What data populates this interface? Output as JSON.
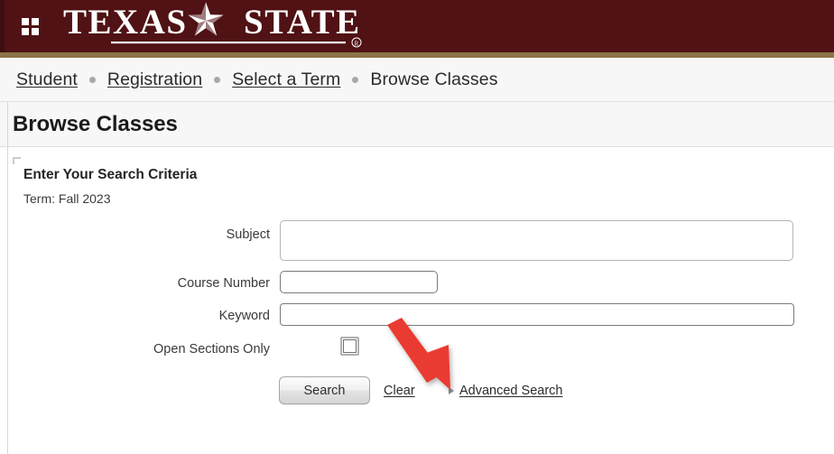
{
  "banner": {
    "menu_icon": "grid-menu-icon",
    "logo_text": "TEXAS STATE",
    "logo_registered_mark": "®",
    "bg_color": "#501214",
    "accent_color": "#8c7447"
  },
  "breadcrumb": {
    "items": [
      {
        "label": "Student",
        "is_link": true
      },
      {
        "label": "Registration",
        "is_link": true
      },
      {
        "label": "Select a Term",
        "is_link": true
      },
      {
        "label": "Browse Classes",
        "is_link": false
      }
    ],
    "separator": "•"
  },
  "page": {
    "title": "Browse Classes"
  },
  "search_form": {
    "legend": "Enter Your Search Criteria",
    "term_line": "Term: Fall 2023",
    "fields": [
      {
        "label": "Subject",
        "value": "",
        "placeholder": "",
        "type": "multiselect"
      },
      {
        "label": "Course Number",
        "value": "",
        "placeholder": "",
        "type": "text"
      },
      {
        "label": "Keyword",
        "value": "",
        "placeholder": "",
        "type": "text"
      }
    ],
    "checkbox": {
      "label": "Open Sections Only",
      "checked": false
    },
    "actions": {
      "search_label": "Search",
      "clear_label": "Clear",
      "advanced_label": "Advanced Search",
      "advanced_marker": "▶"
    }
  },
  "annotation": {
    "arrow": {
      "name": "red-arrow-annotation",
      "color": "#ea3b30",
      "points_to": "Advanced Search",
      "direction": "down-right"
    }
  }
}
